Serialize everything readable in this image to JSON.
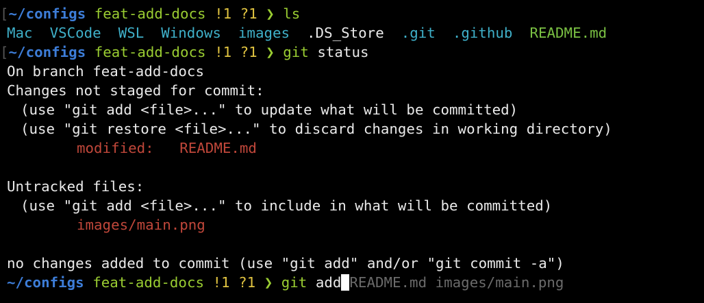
{
  "prompt": {
    "bracket": "[",
    "dir": "~/configs",
    "branch": "feat-add-docs",
    "modified": "!1",
    "untracked": "?1",
    "arrow": "❯"
  },
  "lines": {
    "cmd1": "ls",
    "ls_items": [
      {
        "name": "Mac",
        "color": "#3fb0c9"
      },
      {
        "name": "VSCode",
        "color": "#3fb0c9"
      },
      {
        "name": "WSL",
        "color": "#3fb0c9"
      },
      {
        "name": "Windows",
        "color": "#3fb0c9"
      },
      {
        "name": "images",
        "color": "#3fb0c9"
      },
      {
        "name": ".DS_Store",
        "color": "#eaeaea"
      },
      {
        "name": ".git",
        "color": "#3fb0c9"
      },
      {
        "name": ".github",
        "color": "#3fb0c9"
      },
      {
        "name": "README.md",
        "color": "#7ac043"
      }
    ],
    "cmd2_git": "git",
    "cmd2_arg": "status",
    "on_branch": "On branch feat-add-docs",
    "not_staged": "Changes not staged for commit:",
    "hint_add": "(use \"git add <file>...\" to update what will be committed)",
    "hint_restore": "(use \"git restore <file>...\" to discard changes in working directory)",
    "modified_label": "modified:",
    "modified_file": "README.md",
    "untracked_header": "Untracked files:",
    "hint_include": "(use \"git add <file>...\" to include in what will be committed)",
    "untracked_file": "images/main.png",
    "no_changes": "no changes added to commit (use \"git add\" and/or \"git commit -a\")",
    "cmd3_git": "git",
    "cmd3_arg": "add",
    "autosuggest": "README.md images/main.png"
  },
  "colors": {
    "background": "#000000",
    "dir": "#3d7dd8",
    "branch": "#9acd32",
    "flags": "#e0c341",
    "cyan": "#3fb0c9",
    "green": "#7ac043",
    "red": "#c0473a",
    "ghost": "#6a6a6a"
  }
}
